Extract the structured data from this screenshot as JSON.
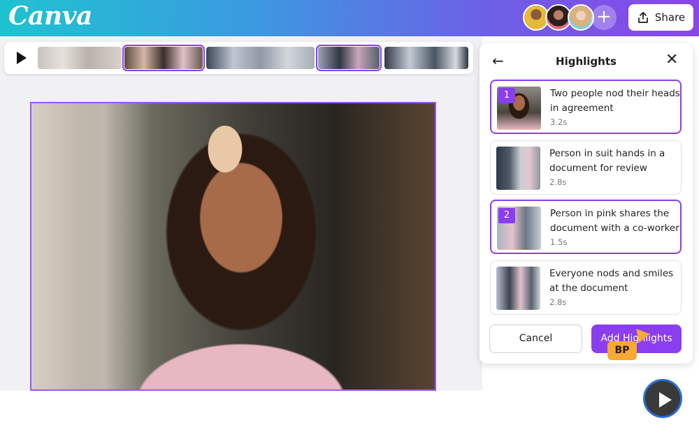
{
  "app": {
    "logo": "Canva"
  },
  "header": {
    "share_label": "Share",
    "add_collaborator_symbol": "+",
    "share_icon": "share-icon"
  },
  "colors": {
    "accent": "#8b3df0",
    "topbar_gradient_start": "#1ec3cf",
    "topbar_gradient_end": "#8a46e8",
    "cursor_tag": "#f7a932"
  },
  "panel": {
    "title": "Highlights",
    "items": [
      {
        "badge": "1",
        "title": "Two people nod their heads in agreement",
        "duration": "3.2s",
        "selected": true
      },
      {
        "badge": "",
        "title": "Person in suit hands in a document for review",
        "duration": "2.8s",
        "selected": false
      },
      {
        "badge": "2",
        "title": "Person in pink shares the document with a co-worker",
        "duration": "1.5s",
        "selected": true
      },
      {
        "badge": "",
        "title": "Everyone nods and smiles at the document",
        "duration": "2.8s",
        "selected": false
      }
    ],
    "cancel_label": "Cancel",
    "add_label": "Add Highlights"
  },
  "collaborator_cursor": {
    "initials": "BP"
  }
}
